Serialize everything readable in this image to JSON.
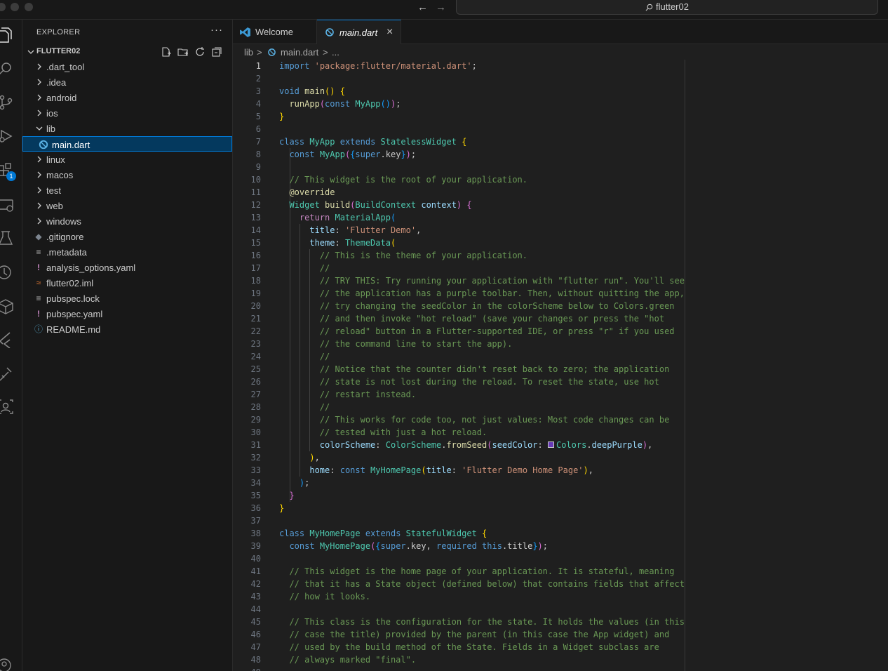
{
  "titlebar": {
    "search_text": "flutter02"
  },
  "activity_bar": {
    "extensions_badge": "1"
  },
  "sidebar": {
    "title": "EXPLORER",
    "more": "···",
    "workspace": "FLUTTER02",
    "items": [
      {
        "label": ".dart_tool",
        "kind": "folder"
      },
      {
        "label": ".idea",
        "kind": "folder"
      },
      {
        "label": "android",
        "kind": "folder"
      },
      {
        "label": "ios",
        "kind": "folder"
      },
      {
        "label": "lib",
        "kind": "folder-open"
      },
      {
        "label": "main.dart",
        "kind": "dart",
        "selected": true
      },
      {
        "label": "linux",
        "kind": "folder"
      },
      {
        "label": "macos",
        "kind": "folder"
      },
      {
        "label": "test",
        "kind": "folder"
      },
      {
        "label": "web",
        "kind": "folder"
      },
      {
        "label": "windows",
        "kind": "folder"
      },
      {
        "label": ".gitignore",
        "kind": "git"
      },
      {
        "label": ".metadata",
        "kind": "lines"
      },
      {
        "label": "analysis_options.yaml",
        "kind": "yaml"
      },
      {
        "label": "flutter02.iml",
        "kind": "rss"
      },
      {
        "label": "pubspec.lock",
        "kind": "lines"
      },
      {
        "label": "pubspec.yaml",
        "kind": "yaml"
      },
      {
        "label": "README.md",
        "kind": "info"
      }
    ]
  },
  "tabs": [
    {
      "label": "Welcome"
    },
    {
      "label": "main.dart",
      "active": true,
      "close": "×"
    }
  ],
  "breadcrumb": {
    "folder": "lib",
    "sep": ">",
    "file": "main.dart",
    "more": "..."
  },
  "editor": {
    "current_line": 1,
    "lines": [
      [
        [
          "kw",
          "import"
        ],
        [
          "",
          " "
        ],
        [
          "st",
          "'package:flutter/material.dart'"
        ],
        [
          "",
          ";"
        ]
      ],
      [],
      [
        [
          "kw",
          "void"
        ],
        [
          "",
          " "
        ],
        [
          "fn",
          "main"
        ],
        [
          "b1",
          "()"
        ],
        [
          "",
          " "
        ],
        [
          "b1",
          "{"
        ]
      ],
      [
        [
          "",
          "  "
        ],
        [
          "fn",
          "runApp"
        ],
        [
          "b2",
          "("
        ],
        [
          "kw",
          "const"
        ],
        [
          "",
          " "
        ],
        [
          "ty",
          "MyApp"
        ],
        [
          "b3",
          "()"
        ],
        [
          "b2",
          ")"
        ],
        [
          "",
          ";"
        ]
      ],
      [
        [
          "b1",
          "}"
        ]
      ],
      [],
      [
        [
          "kw",
          "class"
        ],
        [
          "",
          " "
        ],
        [
          "ty",
          "MyApp"
        ],
        [
          "",
          " "
        ],
        [
          "kw",
          "extends"
        ],
        [
          "",
          " "
        ],
        [
          "ty",
          "StatelessWidget"
        ],
        [
          "",
          " "
        ],
        [
          "b1",
          "{"
        ]
      ],
      [
        [
          "",
          "  "
        ],
        [
          "kw",
          "const"
        ],
        [
          "",
          " "
        ],
        [
          "ty",
          "MyApp"
        ],
        [
          "b2",
          "("
        ],
        [
          "b3",
          "{"
        ],
        [
          "kw",
          "super"
        ],
        [
          "",
          ".key"
        ],
        [
          "b3",
          "}"
        ],
        [
          "b2",
          ")"
        ],
        [
          "",
          ";"
        ]
      ],
      [],
      [
        [
          "cm",
          "  // This widget is the root of your application."
        ]
      ],
      [
        [
          "an",
          "  @override"
        ]
      ],
      [
        [
          "",
          "  "
        ],
        [
          "ty",
          "Widget"
        ],
        [
          "",
          " "
        ],
        [
          "fn",
          "build"
        ],
        [
          "b2",
          "("
        ],
        [
          "ty",
          "BuildContext"
        ],
        [
          "",
          " "
        ],
        [
          "pr",
          "context"
        ],
        [
          "b2",
          ")"
        ],
        [
          "",
          " "
        ],
        [
          "b2",
          "{"
        ]
      ],
      [
        [
          "",
          "    "
        ],
        [
          "ctl",
          "return"
        ],
        [
          "",
          " "
        ],
        [
          "ty",
          "MaterialApp"
        ],
        [
          "b3",
          "("
        ]
      ],
      [
        [
          "",
          "      "
        ],
        [
          "pr",
          "title"
        ],
        [
          "",
          ": "
        ],
        [
          "st",
          "'Flutter Demo'"
        ],
        [
          "",
          ","
        ]
      ],
      [
        [
          "",
          "      "
        ],
        [
          "pr",
          "theme"
        ],
        [
          "",
          ": "
        ],
        [
          "ty",
          "ThemeData"
        ],
        [
          "b1",
          "("
        ]
      ],
      [
        [
          "cm",
          "        // This is the theme of your application."
        ]
      ],
      [
        [
          "cm",
          "        //"
        ]
      ],
      [
        [
          "cm",
          "        // TRY THIS: Try running your application with \"flutter run\". You'll see"
        ]
      ],
      [
        [
          "cm",
          "        // the application has a purple toolbar. Then, without quitting the app,"
        ]
      ],
      [
        [
          "cm",
          "        // try changing the seedColor in the colorScheme below to Colors.green"
        ]
      ],
      [
        [
          "cm",
          "        // and then invoke \"hot reload\" (save your changes or press the \"hot"
        ]
      ],
      [
        [
          "cm",
          "        // reload\" button in a Flutter-supported IDE, or press \"r\" if you used"
        ]
      ],
      [
        [
          "cm",
          "        // the command line to start the app)."
        ]
      ],
      [
        [
          "cm",
          "        //"
        ]
      ],
      [
        [
          "cm",
          "        // Notice that the counter didn't reset back to zero; the application"
        ]
      ],
      [
        [
          "cm",
          "        // state is not lost during the reload. To reset the state, use hot"
        ]
      ],
      [
        [
          "cm",
          "        // restart instead."
        ]
      ],
      [
        [
          "cm",
          "        //"
        ]
      ],
      [
        [
          "cm",
          "        // This works for code too, not just values: Most code changes can be"
        ]
      ],
      [
        [
          "cm",
          "        // tested with just a hot reload."
        ]
      ],
      [
        [
          "",
          "        "
        ],
        [
          "pr",
          "colorScheme"
        ],
        [
          "",
          ": "
        ],
        [
          "ty",
          "ColorScheme"
        ],
        [
          "",
          "."
        ],
        [
          "fn",
          "fromSeed"
        ],
        [
          "b2",
          "("
        ],
        [
          "pr",
          "seedColor"
        ],
        [
          "",
          ": "
        ],
        [
          "swatch",
          ""
        ],
        [
          "ty",
          "Colors"
        ],
        [
          "",
          "."
        ],
        [
          "pr",
          "deepPurple"
        ],
        [
          "b2",
          ")"
        ],
        [
          "",
          ","
        ]
      ],
      [
        [
          "",
          "      "
        ],
        [
          "b1",
          ")"
        ],
        [
          "",
          ","
        ]
      ],
      [
        [
          "",
          "      "
        ],
        [
          "pr",
          "home"
        ],
        [
          "",
          ": "
        ],
        [
          "kw",
          "const"
        ],
        [
          "",
          " "
        ],
        [
          "ty",
          "MyHomePage"
        ],
        [
          "b1",
          "("
        ],
        [
          "pr",
          "title"
        ],
        [
          "",
          ": "
        ],
        [
          "st",
          "'Flutter Demo Home Page'"
        ],
        [
          "b1",
          ")"
        ],
        [
          "",
          ","
        ]
      ],
      [
        [
          "",
          "    "
        ],
        [
          "b3",
          ")"
        ],
        [
          "",
          ";"
        ]
      ],
      [
        [
          "",
          "  "
        ],
        [
          "b2",
          "}"
        ]
      ],
      [
        [
          "b1",
          "}"
        ]
      ],
      [],
      [
        [
          "kw",
          "class"
        ],
        [
          "",
          " "
        ],
        [
          "ty",
          "MyHomePage"
        ],
        [
          "",
          " "
        ],
        [
          "kw",
          "extends"
        ],
        [
          "",
          " "
        ],
        [
          "ty",
          "StatefulWidget"
        ],
        [
          "",
          " "
        ],
        [
          "b1",
          "{"
        ]
      ],
      [
        [
          "",
          "  "
        ],
        [
          "kw",
          "const"
        ],
        [
          "",
          " "
        ],
        [
          "ty",
          "MyHomePage"
        ],
        [
          "b2",
          "("
        ],
        [
          "b3",
          "{"
        ],
        [
          "kw",
          "super"
        ],
        [
          "",
          ".key, "
        ],
        [
          "kw",
          "required"
        ],
        [
          "",
          " "
        ],
        [
          "kw",
          "this"
        ],
        [
          "",
          ".title"
        ],
        [
          "b3",
          "}"
        ],
        [
          "b2",
          ")"
        ],
        [
          "",
          ";"
        ]
      ],
      [],
      [
        [
          "cm",
          "  // This widget is the home page of your application. It is stateful, meaning"
        ]
      ],
      [
        [
          "cm",
          "  // that it has a State object (defined below) that contains fields that affect"
        ]
      ],
      [
        [
          "cm",
          "  // how it looks."
        ]
      ],
      [],
      [
        [
          "cm",
          "  // This class is the configuration for the state. It holds the values (in this"
        ]
      ],
      [
        [
          "cm",
          "  // case the title) provided by the parent (in this case the App widget) and"
        ]
      ],
      [
        [
          "cm",
          "  // used by the build method of the State. Fields in a Widget subclass are"
        ]
      ],
      [
        [
          "cm",
          "  // always marked \"final\"."
        ]
      ],
      []
    ]
  }
}
